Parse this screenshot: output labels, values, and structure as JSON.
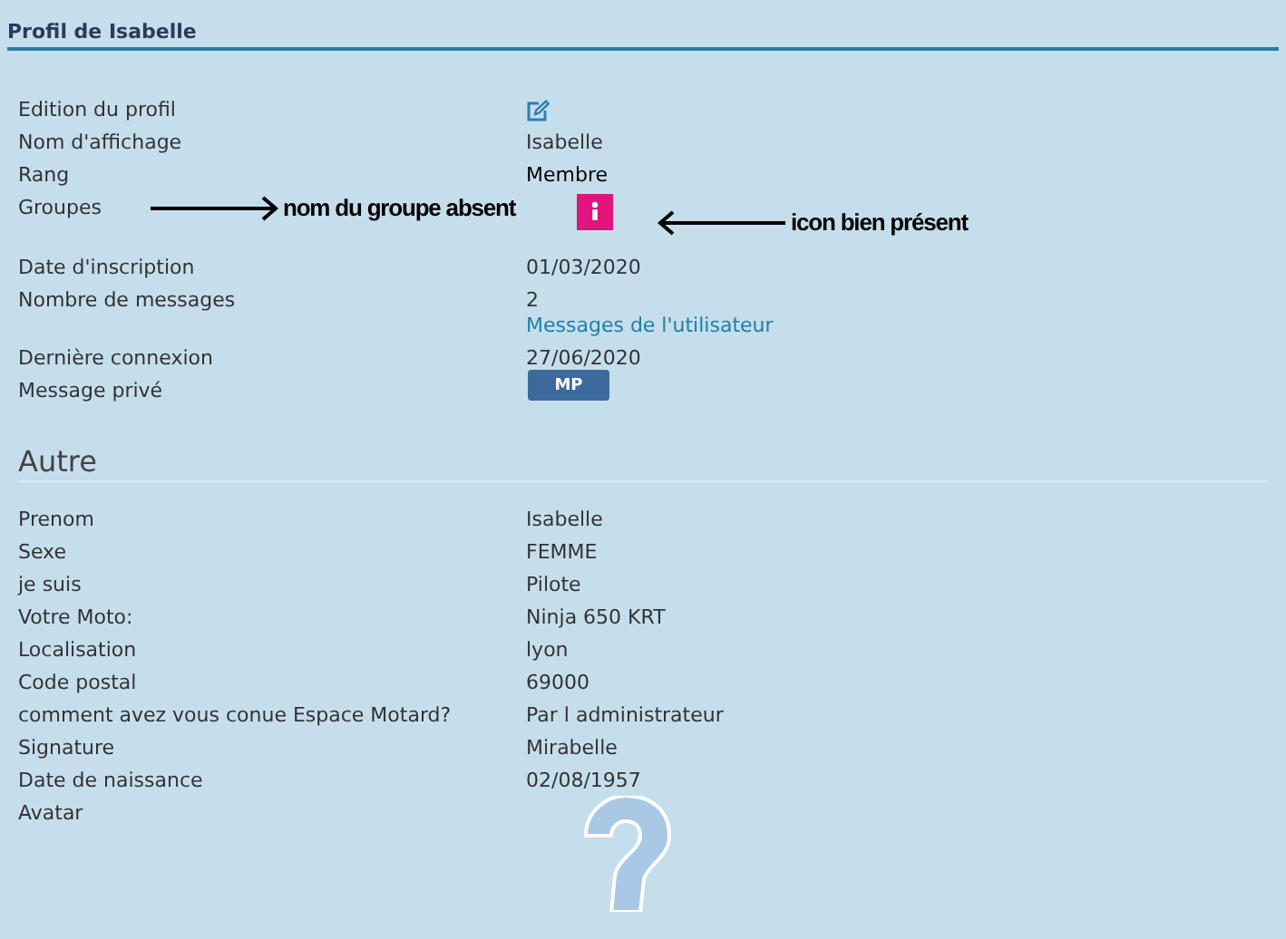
{
  "panel": {
    "title": "Profil de Isabelle"
  },
  "profile_rows": [
    {
      "label": "Edition du profil",
      "kind": "edit"
    },
    {
      "label": "Nom d'affichage",
      "kind": "text",
      "value": "Isabelle"
    },
    {
      "label": "Rang",
      "kind": "rank",
      "value": "Membre"
    },
    {
      "label": "Groupes",
      "kind": "group"
    },
    {
      "label": "Date d'inscription",
      "kind": "text",
      "value": "01/03/2020"
    },
    {
      "label": "Nombre de messages",
      "kind": "text_link",
      "value": "2",
      "link": "Messages de l'utilisateur"
    },
    {
      "label": "Dernière connexion",
      "kind": "text",
      "value": "27/06/2020"
    },
    {
      "label": "Message privé",
      "kind": "button",
      "button": "MP"
    }
  ],
  "annotations": [
    {
      "kind": "right",
      "text": "nom du groupe absent"
    },
    {
      "kind": "left",
      "text": "icon bien présent"
    }
  ],
  "other": {
    "heading": "Autre",
    "rows": [
      {
        "label": "Prenom",
        "value": "Isabelle"
      },
      {
        "label": "Sexe",
        "value": "FEMME"
      },
      {
        "label": "je suis",
        "value": "Pilote"
      },
      {
        "label": "Votre Moto:",
        "value": "Ninja 650 KRT"
      },
      {
        "label": "Localisation",
        "value": "lyon"
      },
      {
        "label": "Code postal",
        "value": "69000"
      },
      {
        "label": "comment avez vous conue Espace Motard?",
        "value": "Par l administrateur"
      },
      {
        "label": "Signature",
        "value": "Mirabelle"
      },
      {
        "label": "Date de naissance",
        "value": "02/08/1957"
      }
    ],
    "avatar_label": "Avatar"
  }
}
